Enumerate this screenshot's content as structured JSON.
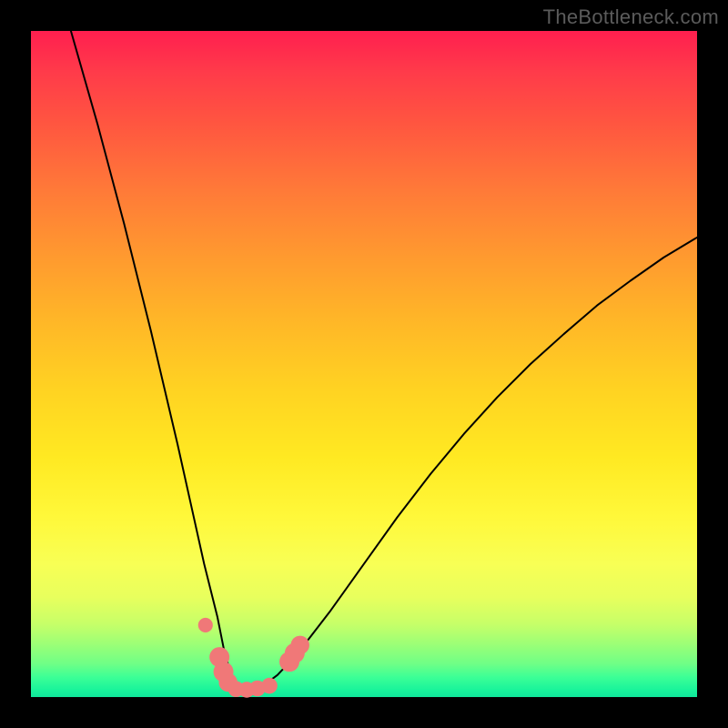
{
  "watermark": "TheBottleneck.com",
  "chart_data": {
    "type": "line",
    "title": "",
    "xlabel": "",
    "ylabel": "",
    "xlim": [
      0,
      100
    ],
    "ylim": [
      0,
      100
    ],
    "grid": false,
    "legend": false,
    "series": [
      {
        "name": "curve",
        "color": "#000000",
        "x": [
          6,
          10,
          14,
          18,
          22,
          24,
          26,
          28,
          29,
          30,
          30.5,
          31,
          32,
          33.5,
          35,
          37,
          40,
          45,
          50,
          55,
          60,
          65,
          70,
          75,
          80,
          85,
          90,
          95,
          100
        ],
        "values": [
          100,
          86,
          71,
          55,
          38,
          29,
          20,
          12,
          7,
          3.5,
          2,
          1.5,
          1.2,
          1.2,
          1.8,
          3.3,
          6.5,
          13,
          20,
          27,
          33.5,
          39.5,
          45,
          50,
          54.5,
          58.8,
          62.5,
          66,
          69
        ]
      }
    ],
    "markers": [
      {
        "name": "dots",
        "color": "#f07878",
        "points": [
          {
            "x": 26.2,
            "y": 10.8,
            "r": 1.1
          },
          {
            "x": 28.3,
            "y": 6.0,
            "r": 1.5
          },
          {
            "x": 28.9,
            "y": 3.8,
            "r": 1.5
          },
          {
            "x": 29.6,
            "y": 2.2,
            "r": 1.4
          },
          {
            "x": 30.8,
            "y": 1.2,
            "r": 1.2
          },
          {
            "x": 32.4,
            "y": 1.1,
            "r": 1.2
          },
          {
            "x": 34.0,
            "y": 1.3,
            "r": 1.2
          },
          {
            "x": 35.8,
            "y": 1.7,
            "r": 1.2
          },
          {
            "x": 38.8,
            "y": 5.3,
            "r": 1.5
          },
          {
            "x": 39.6,
            "y": 6.6,
            "r": 1.5
          },
          {
            "x": 40.4,
            "y": 7.8,
            "r": 1.4
          }
        ]
      }
    ]
  }
}
